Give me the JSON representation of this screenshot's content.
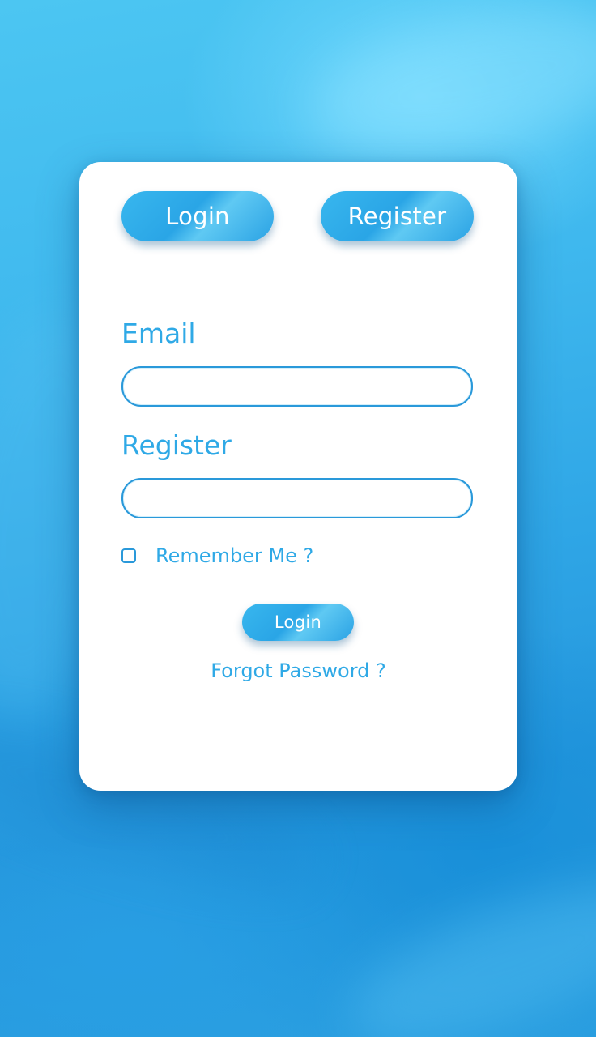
{
  "tabs": {
    "login_label": "Login",
    "register_label": "Register"
  },
  "form": {
    "email_label": "Email",
    "email_value": "",
    "second_label": "Register",
    "second_value": "",
    "remember_label": "Remember Me ?",
    "remember_checked": false,
    "submit_label": "Login",
    "forgot_label": "Forgot Password ?"
  },
  "colors": {
    "accent": "#2fa9e6",
    "button_gradient_start": "#38b7ee",
    "field_border": "#2a99da",
    "card_background": "#ffffff",
    "page_background": "#2fa6e6"
  }
}
